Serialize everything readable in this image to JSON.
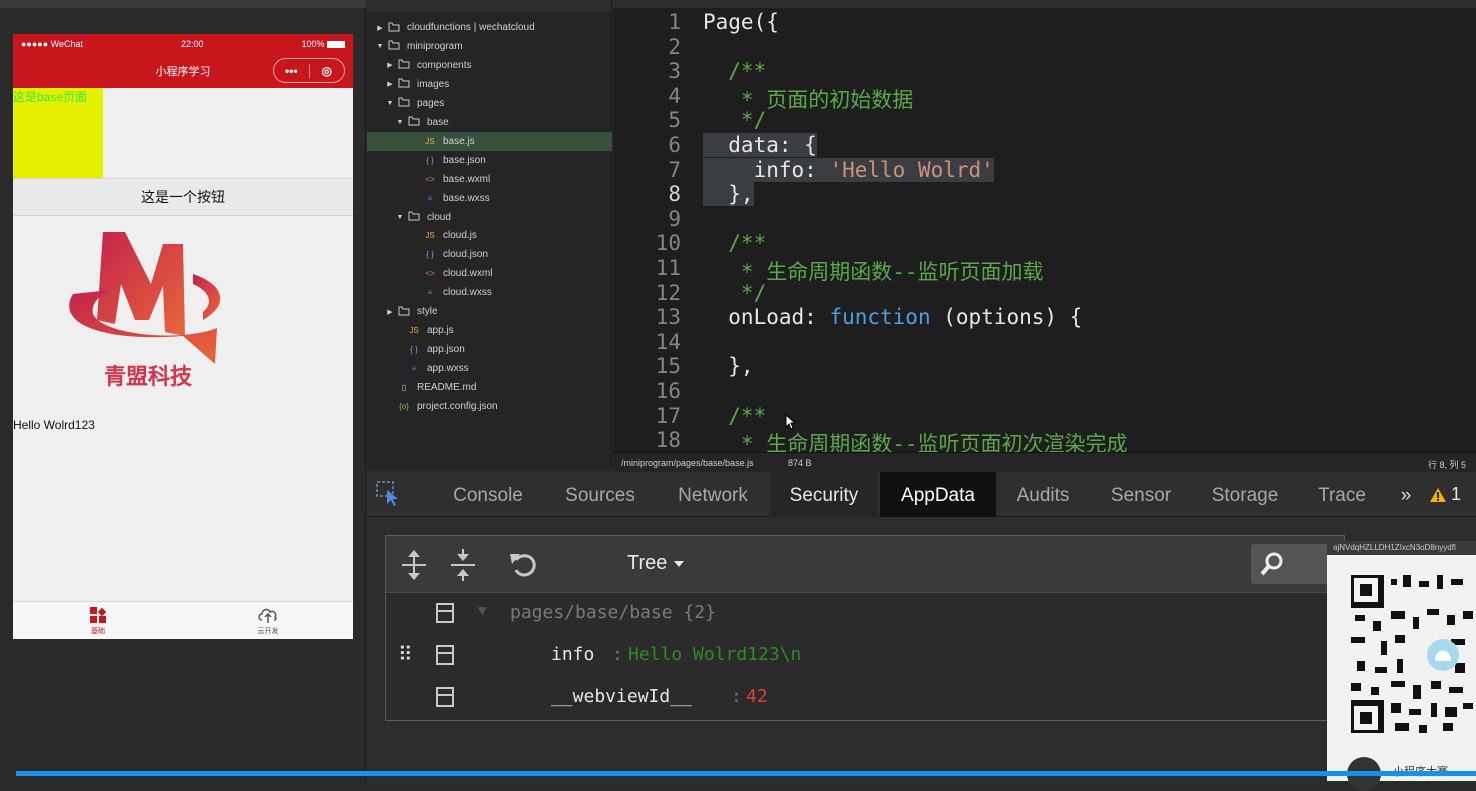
{
  "simulator": {
    "status_bar": {
      "carrier": "●●●●● WeChat",
      "time": "22:00",
      "battery": "100%"
    },
    "nav_title": "小程序学习",
    "capsule": {
      "more": "•••",
      "close": "◎"
    },
    "yellow_text": "这是base页面",
    "button_label": "这是一个按钮",
    "logo_text": "青盟科技",
    "hello_text": "Hello Wolrd123",
    "tabs": [
      {
        "label": "基础",
        "icon": "grid-icon",
        "color": "#c8161d"
      },
      {
        "label": "云开发",
        "icon": "cloud-upload-icon",
        "color": "#555555"
      }
    ]
  },
  "explorer": {
    "items": [
      {
        "label": "cloudfunctions | wechatcloud",
        "type": "folder",
        "expanded": false
      },
      {
        "label": "miniprogram",
        "type": "folder",
        "expanded": true
      },
      {
        "label": "components",
        "type": "folder",
        "expanded": false
      },
      {
        "label": "images",
        "type": "folder",
        "expanded": false
      },
      {
        "label": "pages",
        "type": "folder",
        "expanded": true
      },
      {
        "label": "base",
        "type": "folder",
        "expanded": true
      },
      {
        "label": "base.js",
        "type": "js",
        "active": true
      },
      {
        "label": "base.json",
        "type": "json"
      },
      {
        "label": "base.wxml",
        "type": "wxml"
      },
      {
        "label": "base.wxss",
        "type": "wxss"
      },
      {
        "label": "cloud",
        "type": "folder",
        "expanded": true
      },
      {
        "label": "cloud.js",
        "type": "js"
      },
      {
        "label": "cloud.json",
        "type": "json"
      },
      {
        "label": "cloud.wxml",
        "type": "wxml"
      },
      {
        "label": "cloud.wxss",
        "type": "wxss"
      },
      {
        "label": "style",
        "type": "folder",
        "expanded": false
      },
      {
        "label": "app.js",
        "type": "js"
      },
      {
        "label": "app.json",
        "type": "json"
      },
      {
        "label": "app.wxss",
        "type": "wxss"
      },
      {
        "label": "README.md",
        "type": "md"
      },
      {
        "label": "project.config.json",
        "type": "config"
      }
    ]
  },
  "editor": {
    "lines": [
      {
        "n": "1",
        "parts": [
          {
            "t": "Page({",
            "c": "plain"
          }
        ]
      },
      {
        "n": "2",
        "parts": []
      },
      {
        "n": "3",
        "parts": [
          {
            "t": "  /**",
            "c": "com"
          }
        ]
      },
      {
        "n": "4",
        "parts": [
          {
            "t": "   * 页面的初始数据",
            "c": "com"
          }
        ]
      },
      {
        "n": "5",
        "parts": [
          {
            "t": "   */",
            "c": "com"
          }
        ]
      },
      {
        "n": "6",
        "parts": [
          {
            "t": "  data: {",
            "c": "plain"
          }
        ]
      },
      {
        "n": "7",
        "parts": [
          {
            "t": "    info: ",
            "c": "plain"
          },
          {
            "t": "'Hello Wolrd'",
            "c": "str"
          }
        ]
      },
      {
        "n": "8",
        "parts": [
          {
            "t": "  },",
            "c": "plain"
          }
        ]
      },
      {
        "n": "9",
        "parts": []
      },
      {
        "n": "10",
        "parts": [
          {
            "t": "  /**",
            "c": "com"
          }
        ]
      },
      {
        "n": "11",
        "parts": [
          {
            "t": "   * 生命周期函数--监听页面加载",
            "c": "com"
          }
        ]
      },
      {
        "n": "12",
        "parts": [
          {
            "t": "   */",
            "c": "com"
          }
        ]
      },
      {
        "n": "13",
        "parts": [
          {
            "t": "  onLoad: ",
            "c": "plain"
          },
          {
            "t": "function",
            "c": "kw"
          },
          {
            "t": " (options) {",
            "c": "plain"
          }
        ]
      },
      {
        "n": "14",
        "parts": []
      },
      {
        "n": "15",
        "parts": [
          {
            "t": "  },",
            "c": "plain"
          }
        ]
      },
      {
        "n": "16",
        "parts": []
      },
      {
        "n": "17",
        "parts": [
          {
            "t": "  /**",
            "c": "com"
          }
        ]
      },
      {
        "n": "18",
        "parts": [
          {
            "t": "   * 生命周期函数--监听页面初次渲染完成",
            "c": "com"
          }
        ]
      }
    ],
    "status": {
      "path": "/miniprogram/pages/base/base.js",
      "size": "874 B",
      "position": "行 8, 列 5"
    }
  },
  "devtools": {
    "tabs": [
      "Console",
      "Sources",
      "Network",
      "Security",
      "AppData",
      "Audits",
      "Sensor",
      "Storage",
      "Trace"
    ],
    "active_tab": "AppData",
    "more": "»",
    "warning_count": "1",
    "view_mode": "Tree",
    "tree": {
      "root": "pages/base/base {2}",
      "rows": [
        {
          "key": "info",
          "value": "Hello Wolrd123\\n",
          "value_color": "#2e8b22"
        },
        {
          "key": "__webviewId__",
          "value": "42",
          "value_color": "#d9442f"
        }
      ]
    }
  },
  "overlay": {
    "qr_caption": "ajNVdqHZLLDH1ZIxcN3oD8nyydfl",
    "bottom_text": "小程序大赛"
  }
}
